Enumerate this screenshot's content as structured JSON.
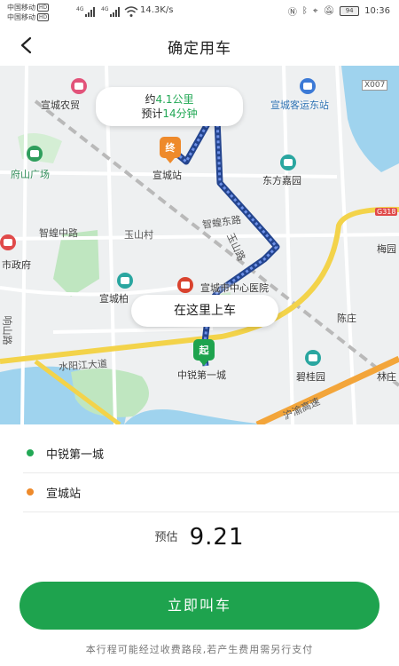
{
  "status_bar": {
    "carrier1": "中国移动",
    "carrier2": "中国移动",
    "hd_badge": "HD",
    "net_type": "4G",
    "speed": "14.3K/s",
    "battery": "94",
    "time": "10:36"
  },
  "header": {
    "title": "确定用车"
  },
  "map": {
    "trip_distance": "约4.1公里",
    "trip_distance_prefix": "约",
    "trip_distance_value": "4.1公里",
    "trip_time_prefix": "预计",
    "trip_time_value": "14分钟",
    "pickup_bubble": "在这里上车",
    "end_marker": "终",
    "start_marker": "起",
    "labels": {
      "farm_trade": "宣城农贸",
      "bus_station": "宣城客运东站",
      "x007": "X007",
      "fushan_square": "府山广场",
      "xuancheng_station": "宣城站",
      "dongfang_garden": "东方嘉园",
      "zhixu_east": "智蝗东路",
      "zhixu_middle": "智蝗中路",
      "yushan_village": "玉山村",
      "yushan_road": "玉山路",
      "g318": "G318",
      "meiyuan": "梅园",
      "city_gov": "市政府",
      "xuancheng_xx": "宣城柏",
      "hospital": "宣城市中心医院",
      "xiangshan_road": "响山路",
      "chenzhuang": "陈庄",
      "shuiyang_river": "水阳江大道",
      "zhongrui": "中锐第一城",
      "biguiyuan": "碧桂园",
      "linzhuang": "林庄",
      "highway": "沪渝高速"
    }
  },
  "trip": {
    "pickup": "中锐第一城",
    "destination": "宣城站"
  },
  "fare": {
    "label": "预估",
    "value": "9.21"
  },
  "actions": {
    "confirm_label": "立即叫车"
  },
  "notice": "本行程可能经过收费路段,若产生费用需另行支付",
  "colors": {
    "brand_green": "#1ea34e",
    "pickup_dot": "#22a855",
    "destination_dot": "#ee8a2b",
    "route_blue": "#3a5fb8"
  }
}
